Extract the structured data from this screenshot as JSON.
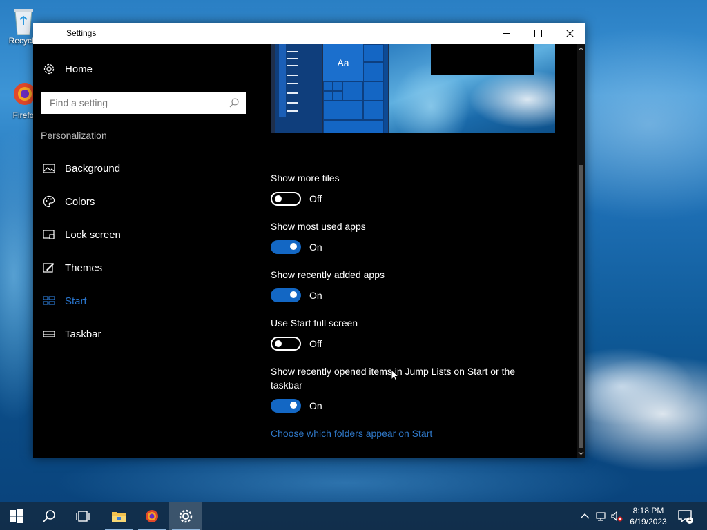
{
  "desktop": {
    "icons": [
      {
        "label": "Recycle"
      },
      {
        "label": "Firefo"
      }
    ]
  },
  "window": {
    "title": "Settings"
  },
  "sidebar": {
    "home_label": "Home",
    "search_placeholder": "Find a setting",
    "section_title": "Personalization",
    "items": [
      {
        "label": "Background",
        "icon": "picture-icon"
      },
      {
        "label": "Colors",
        "icon": "palette-icon"
      },
      {
        "label": "Lock screen",
        "icon": "lock-screen-icon"
      },
      {
        "label": "Themes",
        "icon": "brush-icon"
      },
      {
        "label": "Start",
        "icon": "start-icon",
        "active": true
      },
      {
        "label": "Taskbar",
        "icon": "taskbar-icon"
      }
    ]
  },
  "preview": {
    "tile_text": "Aa"
  },
  "settings": [
    {
      "label": "Show more tiles",
      "state": "Off",
      "on": false
    },
    {
      "label": "Show most used apps",
      "state": "On",
      "on": true
    },
    {
      "label": "Show recently added apps",
      "state": "On",
      "on": true
    },
    {
      "label": "Use Start full screen",
      "state": "Off",
      "on": false
    },
    {
      "label": "Show recently opened items in Jump Lists on Start or the taskbar",
      "state": "On",
      "on": true
    }
  ],
  "link_text": "Choose which folders appear on Start",
  "taskbar": {
    "time": "8:18 PM",
    "date": "6/19/2023",
    "notification_count": "1"
  },
  "colors": {
    "accent": "#1367c4",
    "link": "#2f78c8",
    "active_nav": "#2a77d0"
  }
}
